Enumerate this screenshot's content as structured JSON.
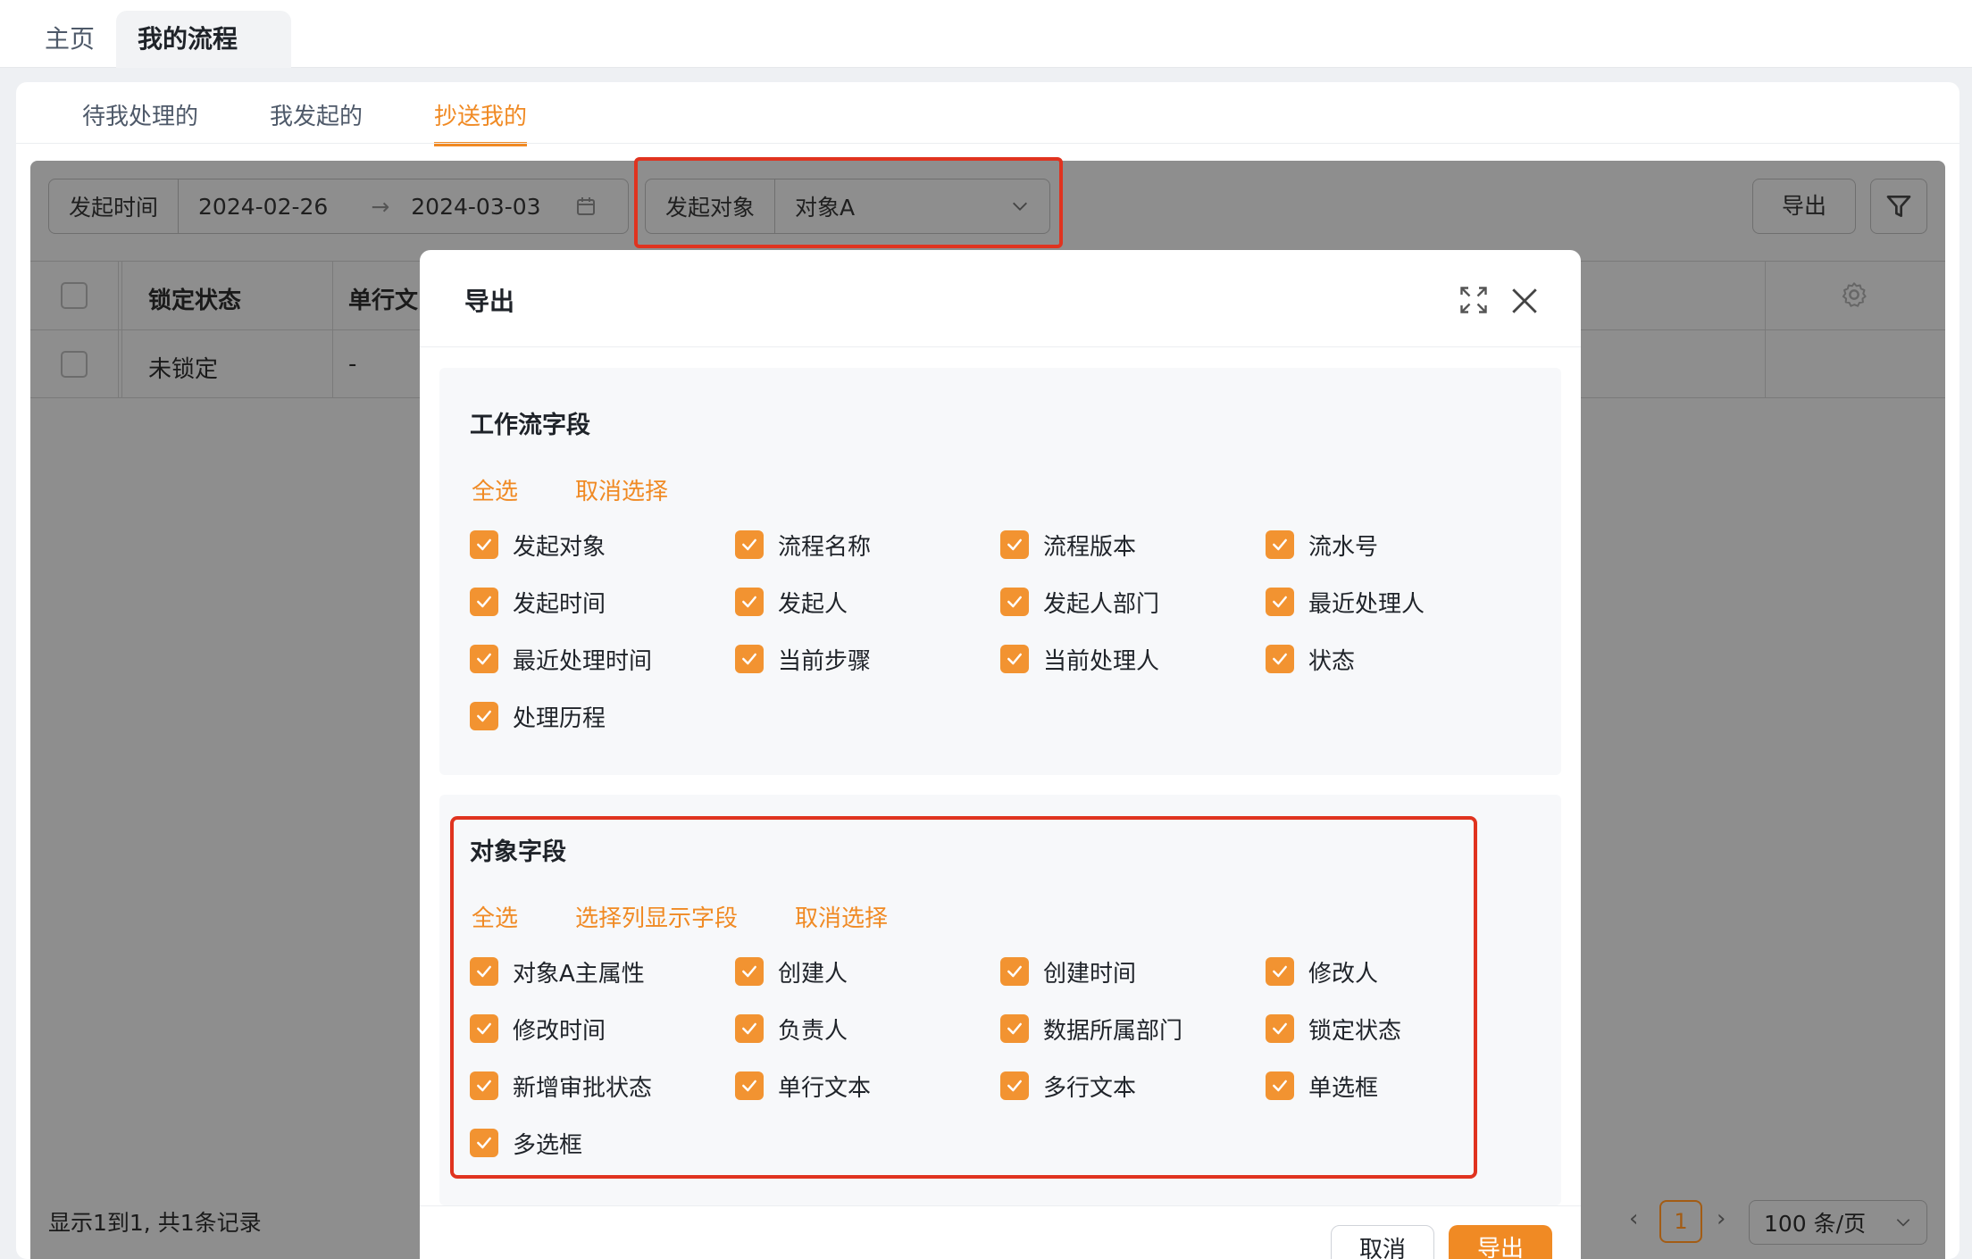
{
  "window_tabs": {
    "home": "主页",
    "active": "我的流程"
  },
  "subtabs": {
    "pending": "待我处理的",
    "initiated": "我发起的",
    "cc": "抄送我的"
  },
  "filter": {
    "date_label": "发起时间",
    "date_start": "2024-02-26",
    "date_end": "2024-03-03",
    "object_label": "发起对象",
    "object_value": "对象A"
  },
  "toolbar": {
    "export": "导出"
  },
  "table": {
    "headers": [
      "锁定状态",
      "单行文"
    ],
    "row": [
      "未锁定",
      "-"
    ]
  },
  "footer": {
    "info": "显示1到1, 共1条记录",
    "page": "1",
    "page_size": "100 条/页"
  },
  "modal": {
    "title": "导出",
    "workflow_section": {
      "title": "工作流字段",
      "select_all": "全选",
      "deselect": "取消选择",
      "fields": [
        "发起对象",
        "流程名称",
        "流程版本",
        "流水号",
        "发起时间",
        "发起人",
        "发起人部门",
        "最近处理人",
        "最近处理时间",
        "当前步骤",
        "当前处理人",
        "状态",
        "处理历程"
      ]
    },
    "object_section": {
      "title": "对象字段",
      "select_all": "全选",
      "select_columns": "选择列显示字段",
      "deselect": "取消选择",
      "fields": [
        "对象A主属性",
        "创建人",
        "创建时间",
        "修改人",
        "修改时间",
        "负责人",
        "数据所属部门",
        "锁定状态",
        "新增审批状态",
        "单行文本",
        "多行文本",
        "单选框",
        "多选框"
      ]
    },
    "cancel": "取消",
    "confirm": "导出"
  },
  "colors": {
    "accent": "#f08a24",
    "highlight": "#e0331f"
  }
}
